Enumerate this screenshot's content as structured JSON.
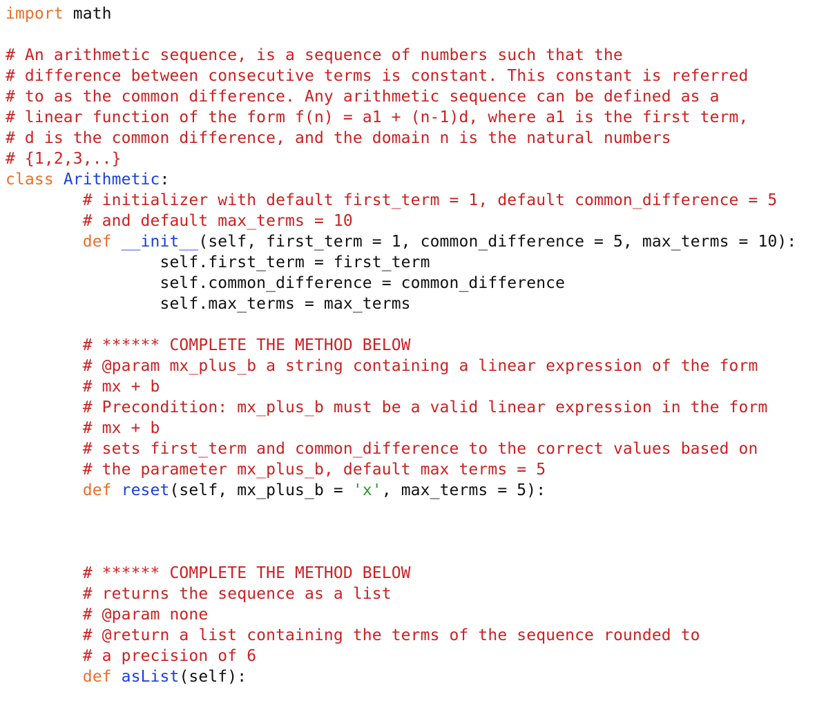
{
  "colors": {
    "keyword": "#e8702a",
    "comment": "#cc2121",
    "function_name": "#1b3fe2",
    "string": "#2b9b2b",
    "text": "#111111",
    "background": "#ffffff"
  },
  "language": "python",
  "lines": [
    {
      "indent": "",
      "tokens": [
        {
          "t": "kw",
          "v": "import"
        },
        {
          "t": "tx",
          "v": " math"
        }
      ]
    },
    {
      "indent": "",
      "tokens": []
    },
    {
      "indent": "",
      "tokens": [
        {
          "t": "cm",
          "v": "# An arithmetic sequence, is a sequence of numbers such that the"
        }
      ]
    },
    {
      "indent": "",
      "tokens": [
        {
          "t": "cm",
          "v": "# difference between consecutive terms is constant. This constant is referred"
        }
      ]
    },
    {
      "indent": "",
      "tokens": [
        {
          "t": "cm",
          "v": "# to as the common difference. Any arithmetic sequence can be defined as a"
        }
      ]
    },
    {
      "indent": "",
      "tokens": [
        {
          "t": "cm",
          "v": "# linear function of the form f(n) = a1 + (n-1)d, where a1 is the first term,"
        }
      ]
    },
    {
      "indent": "",
      "tokens": [
        {
          "t": "cm",
          "v": "# d is the common difference, and the domain n is the natural numbers"
        }
      ]
    },
    {
      "indent": "",
      "tokens": [
        {
          "t": "cm",
          "v": "# {1,2,3,..}"
        }
      ]
    },
    {
      "indent": "",
      "tokens": [
        {
          "t": "kw",
          "v": "class"
        },
        {
          "t": "tx",
          "v": " "
        },
        {
          "t": "fn",
          "v": "Arithmetic"
        },
        {
          "t": "tx",
          "v": ":"
        }
      ]
    },
    {
      "indent": "        ",
      "tokens": [
        {
          "t": "cm",
          "v": "# initializer with default first_term = 1, default common_difference = 5"
        }
      ]
    },
    {
      "indent": "        ",
      "tokens": [
        {
          "t": "cm",
          "v": "# and default max_terms = 10"
        }
      ]
    },
    {
      "indent": "        ",
      "tokens": [
        {
          "t": "kw",
          "v": "def"
        },
        {
          "t": "tx",
          "v": " "
        },
        {
          "t": "fn",
          "v": "__init__"
        },
        {
          "t": "tx",
          "v": "(self, first_term = 1, common_difference = 5, max_terms = 10):"
        }
      ]
    },
    {
      "indent": "                ",
      "tokens": [
        {
          "t": "tx",
          "v": "self.first_term = first_term"
        }
      ]
    },
    {
      "indent": "                ",
      "tokens": [
        {
          "t": "tx",
          "v": "self.common_difference = common_difference"
        }
      ]
    },
    {
      "indent": "                ",
      "tokens": [
        {
          "t": "tx",
          "v": "self.max_terms = max_terms"
        }
      ]
    },
    {
      "indent": "",
      "tokens": []
    },
    {
      "indent": "        ",
      "tokens": [
        {
          "t": "cm",
          "v": "# ****** COMPLETE THE METHOD BELOW"
        }
      ]
    },
    {
      "indent": "        ",
      "tokens": [
        {
          "t": "cm",
          "v": "# @param mx_plus_b a string containing a linear expression of the form"
        }
      ]
    },
    {
      "indent": "        ",
      "tokens": [
        {
          "t": "cm",
          "v": "# mx + b"
        }
      ]
    },
    {
      "indent": "        ",
      "tokens": [
        {
          "t": "cm",
          "v": "# Precondition: mx_plus_b must be a valid linear expression in the form"
        }
      ]
    },
    {
      "indent": "        ",
      "tokens": [
        {
          "t": "cm",
          "v": "# mx + b"
        }
      ]
    },
    {
      "indent": "        ",
      "tokens": [
        {
          "t": "cm",
          "v": "# sets first_term and common_difference to the correct values based on"
        }
      ]
    },
    {
      "indent": "        ",
      "tokens": [
        {
          "t": "cm",
          "v": "# the parameter mx_plus_b, default max terms = 5"
        }
      ]
    },
    {
      "indent": "        ",
      "tokens": [
        {
          "t": "kw",
          "v": "def"
        },
        {
          "t": "tx",
          "v": " "
        },
        {
          "t": "fn",
          "v": "reset"
        },
        {
          "t": "tx",
          "v": "(self, mx_plus_b = "
        },
        {
          "t": "st",
          "v": "'x'"
        },
        {
          "t": "tx",
          "v": ", max_terms = 5):"
        }
      ]
    },
    {
      "indent": "",
      "tokens": []
    },
    {
      "indent": "",
      "tokens": []
    },
    {
      "indent": "",
      "tokens": []
    },
    {
      "indent": "        ",
      "tokens": [
        {
          "t": "cm",
          "v": "# ****** COMPLETE THE METHOD BELOW"
        }
      ]
    },
    {
      "indent": "        ",
      "tokens": [
        {
          "t": "cm",
          "v": "# returns the sequence as a list"
        }
      ]
    },
    {
      "indent": "        ",
      "tokens": [
        {
          "t": "cm",
          "v": "# @param none"
        }
      ]
    },
    {
      "indent": "        ",
      "tokens": [
        {
          "t": "cm",
          "v": "# @return a list containing the terms of the sequence rounded to"
        }
      ]
    },
    {
      "indent": "        ",
      "tokens": [
        {
          "t": "cm",
          "v": "# a precision of 6"
        }
      ]
    },
    {
      "indent": "        ",
      "tokens": [
        {
          "t": "kw",
          "v": "def"
        },
        {
          "t": "tx",
          "v": " "
        },
        {
          "t": "fn",
          "v": "asList"
        },
        {
          "t": "tx",
          "v": "(self):"
        }
      ]
    }
  ]
}
